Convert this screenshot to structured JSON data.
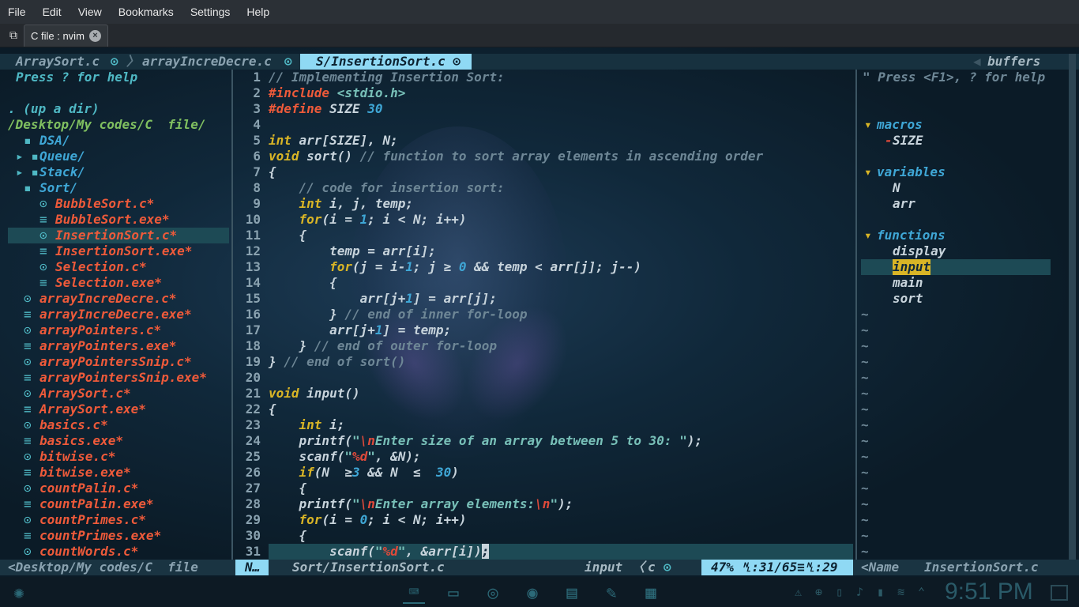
{
  "menu": [
    "File",
    "Edit",
    "View",
    "Bookmarks",
    "Settings",
    "Help"
  ],
  "tab": {
    "label": "C file : nvim",
    "close": "×",
    "new_tab_icon": "terminal-new-tab-icon"
  },
  "tabline": {
    "t1": "ArraySort.c",
    "t2": "arrayIncreDecre.c",
    "t3": "S/InsertionSort.c",
    "sep": "⊙",
    "right": "buffers"
  },
  "tree": {
    "help": "Press ? for help",
    "up": ". (up a dir)",
    "root": "/Desktop/My codes/C  file/",
    "items": [
      {
        "icon": "▪",
        "name": "DSA/",
        "cls": "dir",
        "indent": 1
      },
      {
        "icon": "▸ ▪",
        "name": "Queue/",
        "cls": "dir",
        "indent": 1
      },
      {
        "icon": "▸ ▪",
        "name": "Stack/",
        "cls": "dir",
        "indent": 1
      },
      {
        "icon": "▪",
        "name": "Sort/",
        "cls": "dir",
        "indent": 1
      },
      {
        "icon": "⊙",
        "name": "BubbleSort.c*",
        "cls": "fileC",
        "indent": 2
      },
      {
        "icon": "≡",
        "name": "BubbleSort.exe*",
        "cls": "fileC",
        "indent": 2
      },
      {
        "icon": "⊙",
        "name": "InsertionSort.c*",
        "cls": "fileC",
        "indent": 2,
        "sel": true
      },
      {
        "icon": "≡",
        "name": "InsertionSort.exe*",
        "cls": "fileC",
        "indent": 2
      },
      {
        "icon": "⊙",
        "name": "Selection.c*",
        "cls": "fileC",
        "indent": 2
      },
      {
        "icon": "≡",
        "name": "Selection.exe*",
        "cls": "fileC",
        "indent": 2
      },
      {
        "icon": "⊙",
        "name": "arrayIncreDecre.c*",
        "cls": "fileC",
        "indent": 1
      },
      {
        "icon": "≡",
        "name": "arrayIncreDecre.exe*",
        "cls": "fileC",
        "indent": 1
      },
      {
        "icon": "⊙",
        "name": "arrayPointers.c*",
        "cls": "fileC",
        "indent": 1
      },
      {
        "icon": "≡",
        "name": "arrayPointers.exe*",
        "cls": "fileC",
        "indent": 1
      },
      {
        "icon": "⊙",
        "name": "arrayPointersSnip.c*",
        "cls": "fileC",
        "indent": 1
      },
      {
        "icon": "≡",
        "name": "arrayPointersSnip.exe*",
        "cls": "fileC",
        "indent": 1
      },
      {
        "icon": "⊙",
        "name": "ArraySort.c*",
        "cls": "fileC",
        "indent": 1
      },
      {
        "icon": "≡",
        "name": "ArraySort.exe*",
        "cls": "fileC",
        "indent": 1
      },
      {
        "icon": "⊙",
        "name": "basics.c*",
        "cls": "fileC",
        "indent": 1
      },
      {
        "icon": "≡",
        "name": "basics.exe*",
        "cls": "fileC",
        "indent": 1
      },
      {
        "icon": "⊙",
        "name": "bitwise.c*",
        "cls": "fileC",
        "indent": 1
      },
      {
        "icon": "≡",
        "name": "bitwise.exe*",
        "cls": "fileC",
        "indent": 1
      },
      {
        "icon": "⊙",
        "name": "countPalin.c*",
        "cls": "fileC",
        "indent": 1
      },
      {
        "icon": "≡",
        "name": "countPalin.exe*",
        "cls": "fileC",
        "indent": 1
      },
      {
        "icon": "⊙",
        "name": "countPrimes.c*",
        "cls": "fileC",
        "indent": 1
      },
      {
        "icon": "≡",
        "name": "countPrimes.exe*",
        "cls": "fileC",
        "indent": 1
      },
      {
        "icon": "⊙",
        "name": "countWords.c*",
        "cls": "fileC",
        "indent": 1
      }
    ]
  },
  "code": [
    [
      [
        "cm",
        "// Implementing Insertion Sort:"
      ]
    ],
    [
      [
        "pp",
        "#include "
      ],
      [
        "str",
        "<stdio.h>"
      ]
    ],
    [
      [
        "pp",
        "#define "
      ],
      [
        "",
        "SIZE "
      ],
      [
        "num",
        "30"
      ]
    ],
    [],
    [
      [
        "kw",
        "int "
      ],
      [
        "",
        "arr[SIZE], N;"
      ]
    ],
    [
      [
        "kw",
        "void "
      ],
      [
        "",
        "sort() "
      ],
      [
        "cm",
        "// function to sort array elements in ascending order"
      ]
    ],
    [
      [
        "",
        "{"
      ]
    ],
    [
      [
        "cm",
        "    // code for insertion sort:"
      ]
    ],
    [
      [
        "kw",
        "    int "
      ],
      [
        "",
        "i, j, temp;"
      ]
    ],
    [
      [
        "kw",
        "    for"
      ],
      [
        "",
        "(i = "
      ],
      [
        "num",
        "1"
      ],
      [
        "",
        "; i < N; i++)"
      ]
    ],
    [
      [
        "",
        "    {"
      ]
    ],
    [
      [
        "",
        "        temp = arr[i];"
      ]
    ],
    [
      [
        "kw",
        "        for"
      ],
      [
        "",
        "(j = i-"
      ],
      [
        "num",
        "1"
      ],
      [
        "",
        "; j ≥ "
      ],
      [
        "num",
        "0"
      ],
      [
        "",
        " && temp < arr[j]; j--)"
      ]
    ],
    [
      [
        "",
        "        {"
      ]
    ],
    [
      [
        "",
        "            arr[j+"
      ],
      [
        "num",
        "1"
      ],
      [
        "",
        "] = arr[j];"
      ]
    ],
    [
      [
        "",
        "        } "
      ],
      [
        "cm",
        "// end of inner for-loop"
      ]
    ],
    [
      [
        "",
        "        arr[j+"
      ],
      [
        "num",
        "1"
      ],
      [
        "",
        "] = temp;"
      ]
    ],
    [
      [
        "",
        "    } "
      ],
      [
        "cm",
        "// end of outer for-loop"
      ]
    ],
    [
      [
        "",
        "} "
      ],
      [
        "cm",
        "// end of sort()"
      ]
    ],
    [],
    [
      [
        "kw",
        "void "
      ],
      [
        "",
        "input()"
      ]
    ],
    [
      [
        "",
        "{"
      ]
    ],
    [
      [
        "kw",
        "    int "
      ],
      [
        "",
        "i;"
      ]
    ],
    [
      [
        "",
        "    printf("
      ],
      [
        "str",
        "\""
      ],
      [
        "esc",
        "\\n"
      ],
      [
        "str",
        "Enter size of an array between 5 to 30: \""
      ],
      [
        "",
        ");"
      ]
    ],
    [
      [
        "",
        "    scanf("
      ],
      [
        "str",
        "\""
      ],
      [
        "esc",
        "%d"
      ],
      [
        "str",
        "\""
      ],
      [
        "",
        ", &N);"
      ]
    ],
    [
      [
        "kw",
        "    if"
      ],
      [
        "",
        "(N  ≥"
      ],
      [
        "num",
        "3"
      ],
      [
        "",
        " && N  ≤  "
      ],
      [
        "num",
        "30"
      ],
      [
        "",
        ")"
      ]
    ],
    [
      [
        "",
        "    {"
      ]
    ],
    [
      [
        "",
        "    printf("
      ],
      [
        "str",
        "\""
      ],
      [
        "esc",
        "\\n"
      ],
      [
        "str",
        "Enter array elements:"
      ],
      [
        "esc",
        "\\n"
      ],
      [
        "str",
        "\""
      ],
      [
        "",
        ");"
      ]
    ],
    [
      [
        "kw",
        "    for"
      ],
      [
        "",
        "(i = "
      ],
      [
        "num",
        "0"
      ],
      [
        "",
        "; i < N; i++)"
      ]
    ],
    [
      [
        "",
        "    {"
      ]
    ],
    [
      [
        "",
        "        scanf("
      ],
      [
        "str",
        "\""
      ],
      [
        "esc",
        "%d"
      ],
      [
        "str",
        "\""
      ],
      [
        "",
        ", &arr[i])"
      ],
      [
        "cur",
        ";"
      ]
    ]
  ],
  "tagbar": {
    "help": "\" Press <F1>, ? for help",
    "groups": [
      {
        "title": "macros",
        "items": [
          {
            "name": "SIZE",
            "prefix": "-"
          }
        ]
      },
      {
        "title": "variables",
        "items": [
          {
            "name": "N"
          },
          {
            "name": "arr"
          }
        ]
      },
      {
        "title": "functions",
        "items": [
          {
            "name": "display"
          },
          {
            "name": "input",
            "sel": true
          },
          {
            "name": "main"
          },
          {
            "name": "sort"
          }
        ]
      }
    ],
    "tilde": "~"
  },
  "status": {
    "tree": "<Desktop/My codes/C  file",
    "mode": "N…",
    "file": "Sort/InsertionSort.c",
    "func": "input",
    "lang": "c",
    "pos": "47% ␤:31/65≡␤:29",
    "tag_name": "<Name",
    "tag_file": "InsertionSort.c"
  },
  "clock": "9:51 PM"
}
